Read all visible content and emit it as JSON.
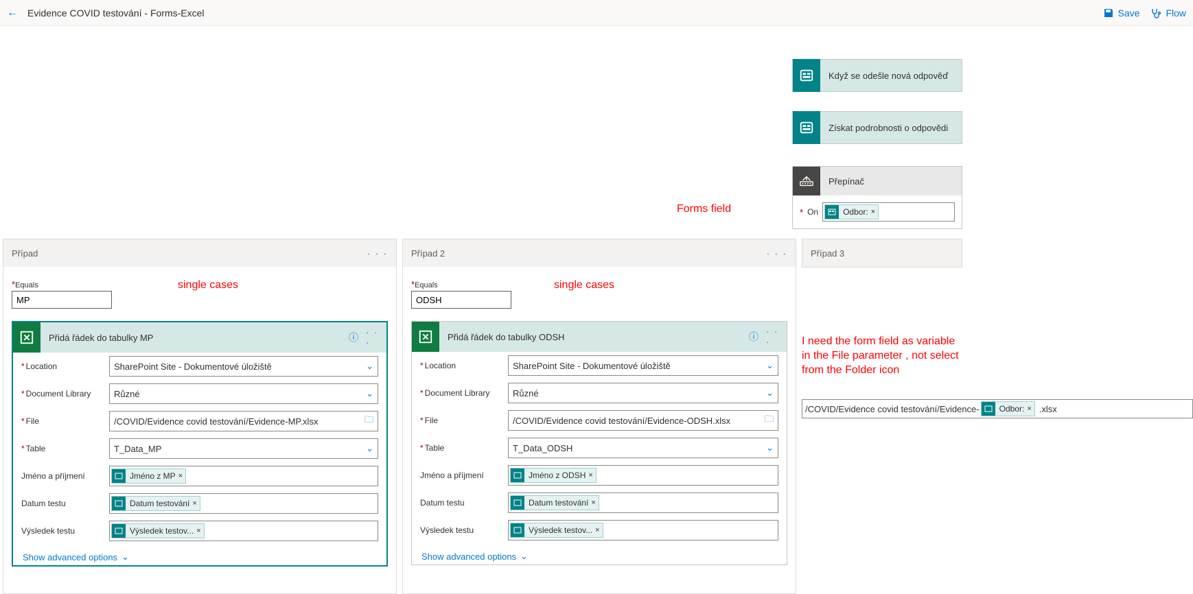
{
  "topbar": {
    "title": "Evidence COVID testování - Forms-Excel",
    "save": "Save",
    "flow": "Flow"
  },
  "nodes": {
    "trigger": "Když se odešle nová odpověď",
    "detail": "Získat podrobnosti o odpovědi",
    "switch": "Přepínač",
    "on_label": "On",
    "on_token": "Odbor:"
  },
  "cases": {
    "c1": {
      "title": "Případ",
      "equals_label": "Equals",
      "equals_value": "MP"
    },
    "c2": {
      "title": "Případ 2",
      "equals_label": "Equals",
      "equals_value": "ODSH"
    },
    "c3": {
      "title": "Případ 3"
    }
  },
  "actions": {
    "a1": {
      "title": "Přidá řádek do tabulky MP",
      "location_lbl": "Location",
      "location_val": "SharePoint Site - Dokumentové úložiště",
      "doclib_lbl": "Document Library",
      "doclib_val": "Různé",
      "file_lbl": "File",
      "file_val": "/COVID/Evidence covid testování/Evidence-MP.xlsx",
      "table_lbl": "Table",
      "table_val": "T_Data_MP",
      "jmeno_lbl": "Jméno a příjmení",
      "jmeno_token": "Jméno z MP",
      "datum_lbl": "Datum testu",
      "datum_token": "Datum testování",
      "vysledek_lbl": "Výsledek testu",
      "vysledek_token": "Výsledek testov...",
      "adv": "Show advanced options"
    },
    "a2": {
      "title": "Přidá řádek do tabulky ODSH",
      "location_lbl": "Location",
      "location_val": "SharePoint Site - Dokumentové úložiště",
      "doclib_lbl": "Document Library",
      "doclib_val": "Různé",
      "file_lbl": "File",
      "file_val": "/COVID/Evidence covid testování/Evidence-ODSH.xlsx",
      "table_lbl": "Table",
      "table_val": "T_Data_ODSH",
      "jmeno_lbl": "Jméno a příjmení",
      "jmeno_token": "Jméno z ODSH",
      "datum_lbl": "Datum testu",
      "datum_token": "Datum testování",
      "vysledek_lbl": "Výsledek testu",
      "vysledek_token": "Výsledek testov...",
      "adv": "Show advanced options"
    }
  },
  "annot": {
    "forms_field": "Forms field",
    "single_cases": "single cases",
    "need_var": "I need the form field as variable in the File parameter , not select from the Folder icon"
  },
  "filebox": {
    "prefix": "/COVID/Evidence covid testování/Evidence-",
    "token": "Odbor:",
    "suffix": ".xlsx"
  }
}
